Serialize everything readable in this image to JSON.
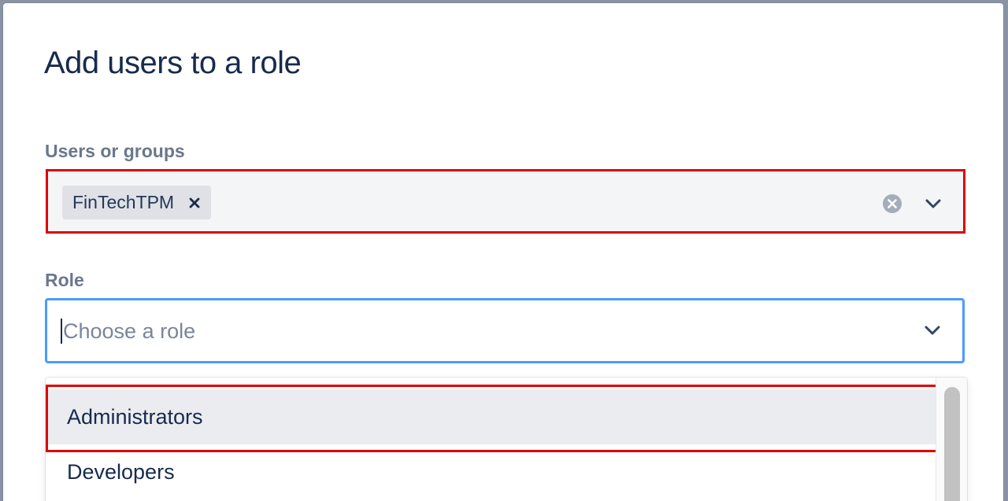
{
  "dialog": {
    "title": "Add users to a role"
  },
  "users_field": {
    "label": "Users or groups",
    "selected": [
      {
        "label": "FinTechTPM",
        "remove_icon": "close-icon"
      }
    ],
    "clear_icon": "clear-circle-icon",
    "dropdown_icon": "chevron-down-icon"
  },
  "role_field": {
    "label": "Role",
    "placeholder": "Choose a role",
    "value": "",
    "dropdown_icon": "chevron-down-icon"
  },
  "role_menu": {
    "options": [
      {
        "label": "Administrators",
        "highlighted": true
      },
      {
        "label": "Developers",
        "highlighted": false
      }
    ]
  },
  "colors": {
    "text_primary": "#172b4d",
    "label": "#6b778c",
    "focus_border": "#4c9aff",
    "annotation_red": "#e00000",
    "field_bg": "#f4f5f7",
    "option_hover_bg": "#ebecf0"
  }
}
